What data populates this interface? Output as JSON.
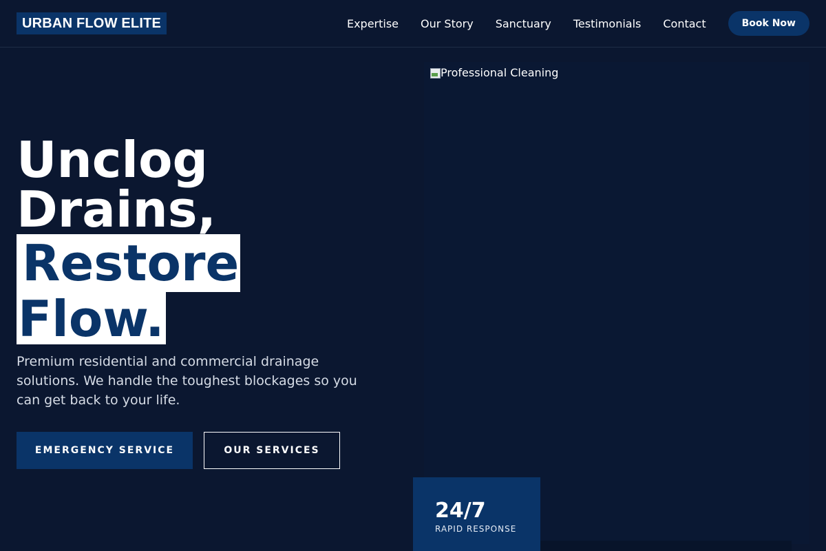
{
  "nav": {
    "logo": "URBAN FLOW ELITE",
    "links": [
      "Expertise",
      "Our Story",
      "Sanctuary",
      "Testimonials",
      "Contact"
    ],
    "cta_label": "Book Now"
  },
  "hero": {
    "title_line1": "Unclog",
    "title_line2": "Drains,",
    "title_highlight1": "Restore",
    "title_highlight2": "Flow.",
    "subtitle": "Premium residential and commercial drainage solutions. We handle the toughest blockages so you can get back to your life.",
    "primary_button": "EMERGENCY SERVICE",
    "secondary_button": "OUR SERVICES",
    "image_alt": "Professional Cleaning",
    "stat_value": "24/7",
    "stat_label": "RAPID RESPONSE"
  },
  "colors": {
    "background": "#0b1730",
    "accent": "#0a3468",
    "highlight_bg": "#ffffff",
    "text": "#ffffff"
  }
}
